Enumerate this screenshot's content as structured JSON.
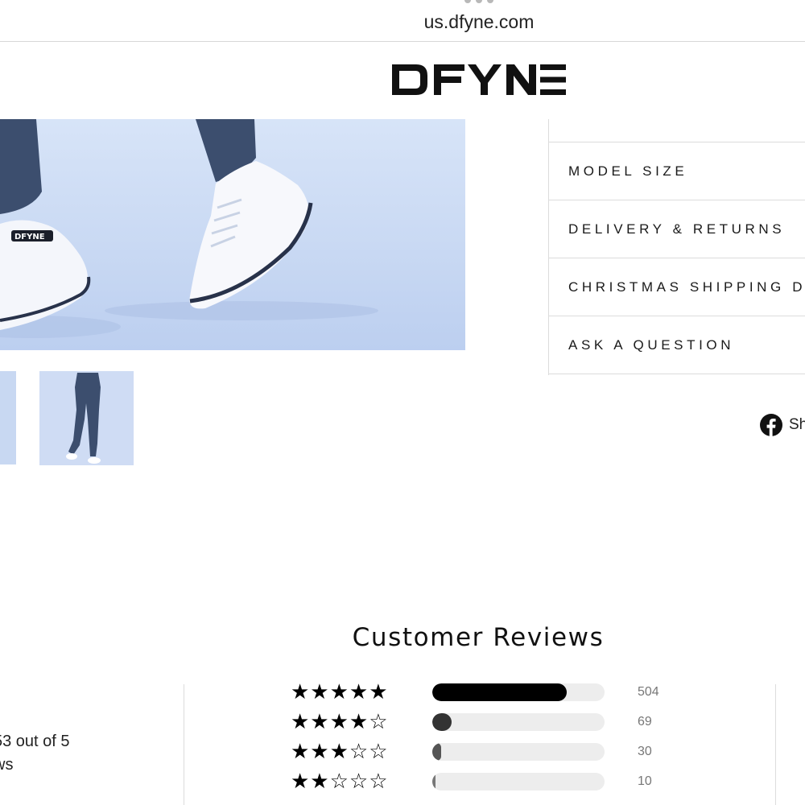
{
  "browser": {
    "url": "us.dfyne.com"
  },
  "header": {
    "logo_text": "DFYNE"
  },
  "product": {
    "accordion": [
      {
        "label": "MODEL SIZE"
      },
      {
        "label": "DELIVERY & RETURNS"
      },
      {
        "label": "CHRISTMAS SHIPPING DA"
      },
      {
        "label": "ASK A QUESTION"
      }
    ],
    "share": {
      "label": "Sh",
      "icon": "facebook-icon"
    }
  },
  "reviews": {
    "title": "Customer Reviews",
    "average_line1": "53 out of 5",
    "average_line2": "ws",
    "histogram": [
      {
        "stars": 5,
        "stars_text": "★★★★★",
        "count": "504",
        "fill_percent": 78,
        "color": "#000000"
      },
      {
        "stars": 4,
        "stars_text": "★★★★☆",
        "count": "69",
        "fill_percent": 11,
        "color": "#333333"
      },
      {
        "stars": 3,
        "stars_text": "★★★☆☆",
        "count": "30",
        "fill_percent": 5,
        "color": "#555555"
      },
      {
        "stars": 2,
        "stars_text": "★★☆☆☆",
        "count": "10",
        "fill_percent": 2,
        "color": "#777777"
      }
    ]
  },
  "colors": {
    "accent": "#000000",
    "image_bg": "#c9d9f3",
    "legging": "#3c4e6e"
  }
}
